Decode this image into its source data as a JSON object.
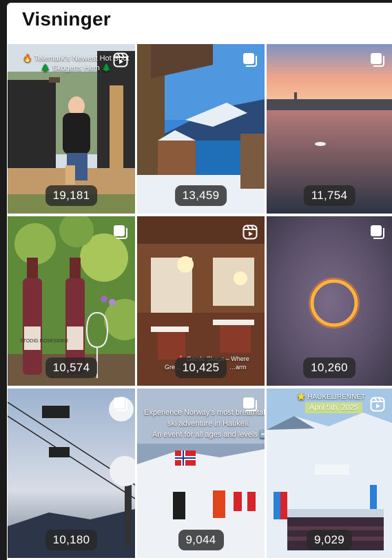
{
  "header": {
    "title": "Visninger"
  },
  "tiles": [
    {
      "views": "19,181",
      "type_icon": "reel-icon",
      "overlay": [
        "🔥 Telemark's Newest Hot Spot",
        "🌲 Skogens Hem 🌲"
      ]
    },
    {
      "views": "13,459",
      "type_icon": "carousel-icon"
    },
    {
      "views": "11,754",
      "type_icon": "carousel-icon"
    },
    {
      "views": "10,574",
      "type_icon": "carousel-icon",
      "label": "STODIG ROSESIDER"
    },
    {
      "views": "10,425",
      "type_icon": "reel-icon",
      "overlay": [
        "📍 Gamle Skaga – Where",
        "Gre…",
        "…arm"
      ]
    },
    {
      "views": "10,260",
      "type_icon": "carousel-icon"
    },
    {
      "views": "10,180",
      "type_icon": "carousel-icon"
    },
    {
      "views": "9,044",
      "type_icon": "carousel-icon",
      "overlay": [
        "Experience Norway's most breathtaking",
        "ski adventure in Haukeli.",
        "An event for all ages and levels ➡️"
      ]
    },
    {
      "views": "9,029",
      "type_icon": "reel-icon",
      "overlay": [
        "🌟 HAUKELIRENNET"
      ],
      "date": "April 5th, 2025"
    }
  ]
}
